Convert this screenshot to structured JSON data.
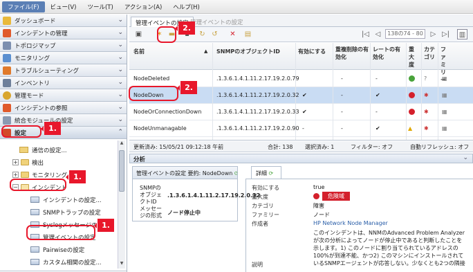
{
  "menubar": {
    "items": [
      "ファイル(F)",
      "ビュー(V)",
      "ツール(T)",
      "アクション(A)",
      "ヘルプ(H)"
    ]
  },
  "sidebar": {
    "sections": [
      {
        "label": "ダッシュボード"
      },
      {
        "label": "インシデントの管理"
      },
      {
        "label": "トポロジマップ"
      },
      {
        "label": "モニタリング"
      },
      {
        "label": "トラブルシューティング"
      },
      {
        "label": "インベントリ"
      },
      {
        "label": "管理モード"
      },
      {
        "label": "インシデントの参照"
      },
      {
        "label": "統合モジュールの設定"
      },
      {
        "label": "設定"
      }
    ],
    "tree": {
      "comm": "通信の設定...",
      "discovery": "検出",
      "monitoring": "モニタリング",
      "incident": "インシデント",
      "incident_settings": "インシデントの設定...",
      "snmp_trap": "SNMPトラップの設定",
      "syslog": "Syslogメッセージの設定",
      "mgmt_event": "管理イベントの設定",
      "pairwise": "Pairwiseの設定",
      "custom_corr": "カスタム相関の設定..."
    }
  },
  "tabs": {
    "active": "管理イベントの設定",
    "inactive": "管理イベントの設定"
  },
  "toolbar": {
    "page_indicator": "138の74 - 80"
  },
  "grid": {
    "headers": {
      "name": "名前",
      "oid": "SNMPのオブジェクトID",
      "enabled": "有効にする",
      "dup": "重複削除の有効化",
      "rate": "レートの有効化",
      "severity": "重大度",
      "category": "カテゴリ",
      "family": "ファミリー"
    },
    "rows": [
      {
        "name": "NodeDeleted",
        "oid": ".1.3.6.1.4.1.11.2.17.19.2.0.79",
        "enabled": "",
        "dup": "-",
        "rate": "-"
      },
      {
        "name": "NodeDown",
        "oid": ".1.3.6.1.4.1.11.2.17.19.2.0.32",
        "enabled": "✔",
        "dup": "-",
        "rate": "✔"
      },
      {
        "name": "NodeOrConnectionDown",
        "oid": ".1.3.6.1.4.1.11.2.17.19.2.0.33",
        "enabled": "✔",
        "dup": "-",
        "rate": "-"
      },
      {
        "name": "NodeUnmanagable",
        "oid": ".1.3.6.1.4.1.11.2.17.19.2.0.90",
        "enabled": "-",
        "dup": "-",
        "rate": "✔"
      }
    ]
  },
  "status": {
    "updated": "更新済み: 15/05/21 09:12:18 午前",
    "total": "合計: 138",
    "selected": "選択済み: 1",
    "filter": "フィルター: オフ",
    "auto_refresh": "自動リフレッシュ: オフ"
  },
  "analysis": {
    "title": "分析",
    "summary_title": "管理イベントの設定 要約: NodeDown",
    "oid_label": "SNMPのオブジェクトID",
    "oid_value": ".1.3.6.1.4.1.11.2.17.19.2.0.32",
    "msg_label": "メッセージの形式",
    "msg_value": "ノード停止中",
    "detail_tab": "詳細",
    "details": {
      "enabled_k": "有効にする",
      "enabled_v": "true",
      "severity_k": "重大度",
      "severity_v": "危険域",
      "category_k": "カテゴリ",
      "category_v": "障害",
      "family_k": "ファミリー",
      "family_v": "ノード",
      "author_k": "作成者",
      "author_v": "HP Network Node Manager",
      "desc_k": "説明",
      "desc_lines": [
        "このインシデントは、NNMのAdvanced Problem Analyzer",
        "が次の分析によってノードが停止中であると判断したことを",
        "示します。1) このノードに割り当てられているアドレスの",
        "100%が到達不能、かつ2) このマシンにインストールされて",
        "いるSNMPエージェントが応答しない。少なくとも2つの隣接"
      ]
    }
  },
  "callouts": {
    "c2_toolbar": "2.",
    "c2_row": "2.",
    "c1_settings": "1.",
    "c1_incident": "1.",
    "c1_mgmt": "1."
  },
  "colors": {
    "callout": "#e8172b",
    "selection": "#c9dcf3",
    "critical": "#d4202c"
  }
}
